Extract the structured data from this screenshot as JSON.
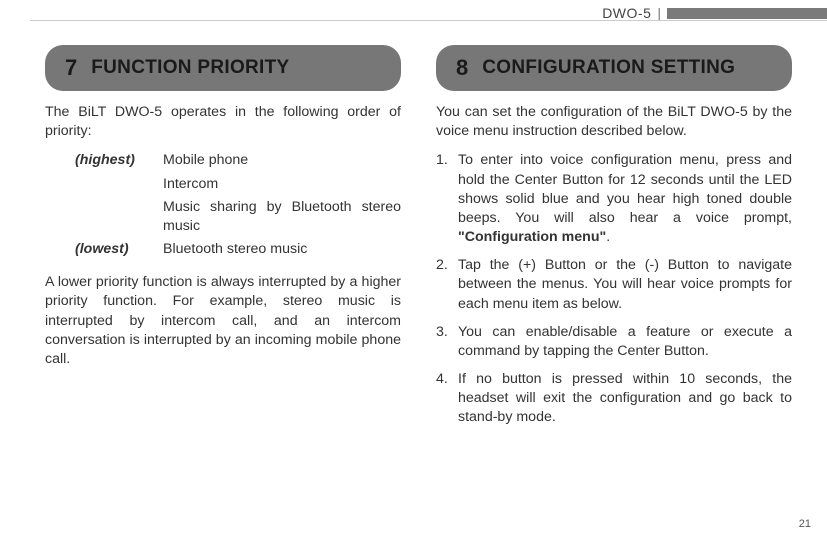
{
  "header": {
    "device": "DWO-5"
  },
  "page_number": "21",
  "left": {
    "section_number": "7",
    "section_title": "FUNCTION PRIORITY",
    "intro": "The BiLT DWO-5 operates in the following order of priority:",
    "priority": {
      "highest_label": "(highest)",
      "lowest_label": "(lowest)",
      "items": {
        "p0": "Mobile phone",
        "p1": "Intercom",
        "p2": "Music sharing by Bluetooth stereo music",
        "p3": "Bluetooth stereo music"
      }
    },
    "note": "A lower priority function is always interrupted by a higher priority function. For example, stereo music is interrupted by intercom call, and an intercom conversation is interrupted by an incoming mobile phone call."
  },
  "right": {
    "section_number": "8",
    "section_title": "CONFIGURATION SETTING",
    "intro": "You can set the configuration of the BiLT DWO-5 by the voice menu instruction described below.",
    "steps": {
      "s1a": "To enter into voice configuration menu, press and hold the Center Button for 12 seconds until the LED shows solid blue and you hear high toned double beeps. You will also hear a voice prompt, ",
      "s1b": "\"Configuration menu\"",
      "s1c": ".",
      "s2": "Tap the (+) Button or the (-) Button to navigate between the menus. You will hear voice prompts for each menu item as below.",
      "s3": "You can enable/disable a feature or execute a command by tapping the Center Button.",
      "s4": "If no button is pressed within 10 seconds, the headset will exit the configuration and go back to stand-by mode."
    }
  }
}
